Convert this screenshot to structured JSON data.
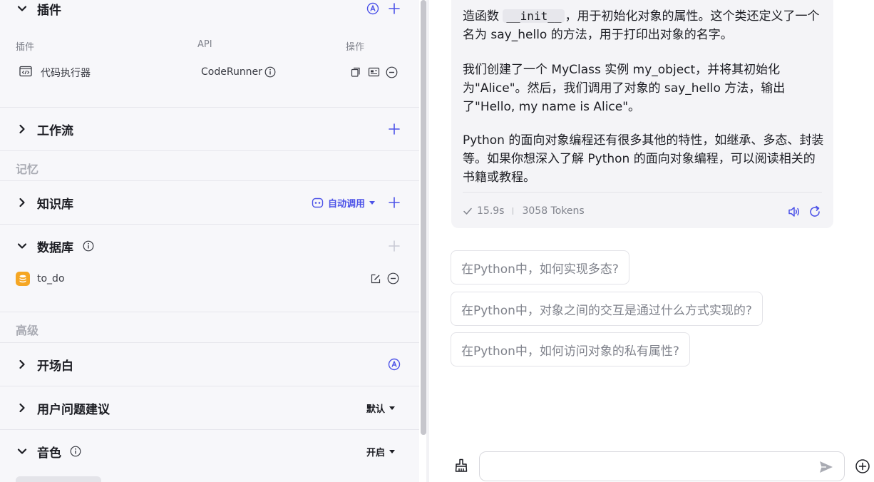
{
  "left": {
    "plugins": {
      "title": "插件",
      "col_plugin": "插件",
      "col_api": "API",
      "col_ops": "操作",
      "row": {
        "name": "代码执行器",
        "api": "CodeRunner"
      }
    },
    "workflow": {
      "title": "工作流"
    },
    "memory_label": "记忆",
    "knowledge": {
      "title": "知识库",
      "mode": "自动调用"
    },
    "database": {
      "title": "数据库",
      "item": "to_do"
    },
    "advanced_label": "高级",
    "opening": {
      "title": "开场白"
    },
    "suggestions": {
      "title": "用户问题建议",
      "value": "默认"
    },
    "voice": {
      "title": "音色",
      "value": "开启"
    }
  },
  "chat": {
    "para1_a": "造函数 ",
    "para1_code": "__init__",
    "para1_b": "，用于初始化对象的属性。这个类还定义了一个名为 say_hello 的方法，用于打印出对象的名字。",
    "para2": "我们创建了一个 MyClass 实例 my_object，并将其初始化为\"Alice\"。然后，我们调用了对象的 say_hello 方法，输出了\"Hello, my name is Alice\"。",
    "para3": "Python 的面向对象编程还有很多其他的特性，如继承、多态、封装等。如果你想深入了解 Python 的面向对象编程，可以阅读相关的书籍或教程。",
    "time": "15.9s",
    "tokens": "3058 Tokens",
    "suggested": [
      "在Python中，如何实现多态?",
      "在Python中，对象之间的交互是通过什么方式实现的?",
      "在Python中，如何访问对象的私有属性?"
    ],
    "input_placeholder": ""
  },
  "colors": {
    "accent": "#4d53e8",
    "muted": "#80838c",
    "db_icon": "#f5a623"
  }
}
